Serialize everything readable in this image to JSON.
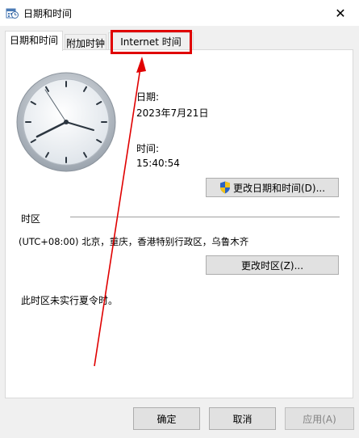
{
  "window": {
    "title": "日期和时间",
    "close_glyph": "✕"
  },
  "tabs": [
    {
      "label": "日期和时间",
      "active": true
    },
    {
      "label": "附加时钟",
      "active": false
    },
    {
      "label": "Internet 时间",
      "active": false
    }
  ],
  "date_section": {
    "date_label": "日期:",
    "date_value": "2023年7月21日",
    "time_label": "时间:",
    "time_value": "15:40:54",
    "change_datetime_button": "更改日期和时间(D)..."
  },
  "timezone_section": {
    "heading": "时区",
    "timezone_value": "(UTC+08:00) 北京，重庆，香港特别行政区，乌鲁木齐",
    "change_timezone_button": "更改时区(Z)...",
    "dst_note": "此时区未实行夏令时。"
  },
  "footer": {
    "ok_button": "确定",
    "cancel_button": "取消",
    "apply_button": "应用(A)"
  },
  "annotation": {
    "color": "#e00000",
    "highlight_target": "Internet 时间"
  }
}
